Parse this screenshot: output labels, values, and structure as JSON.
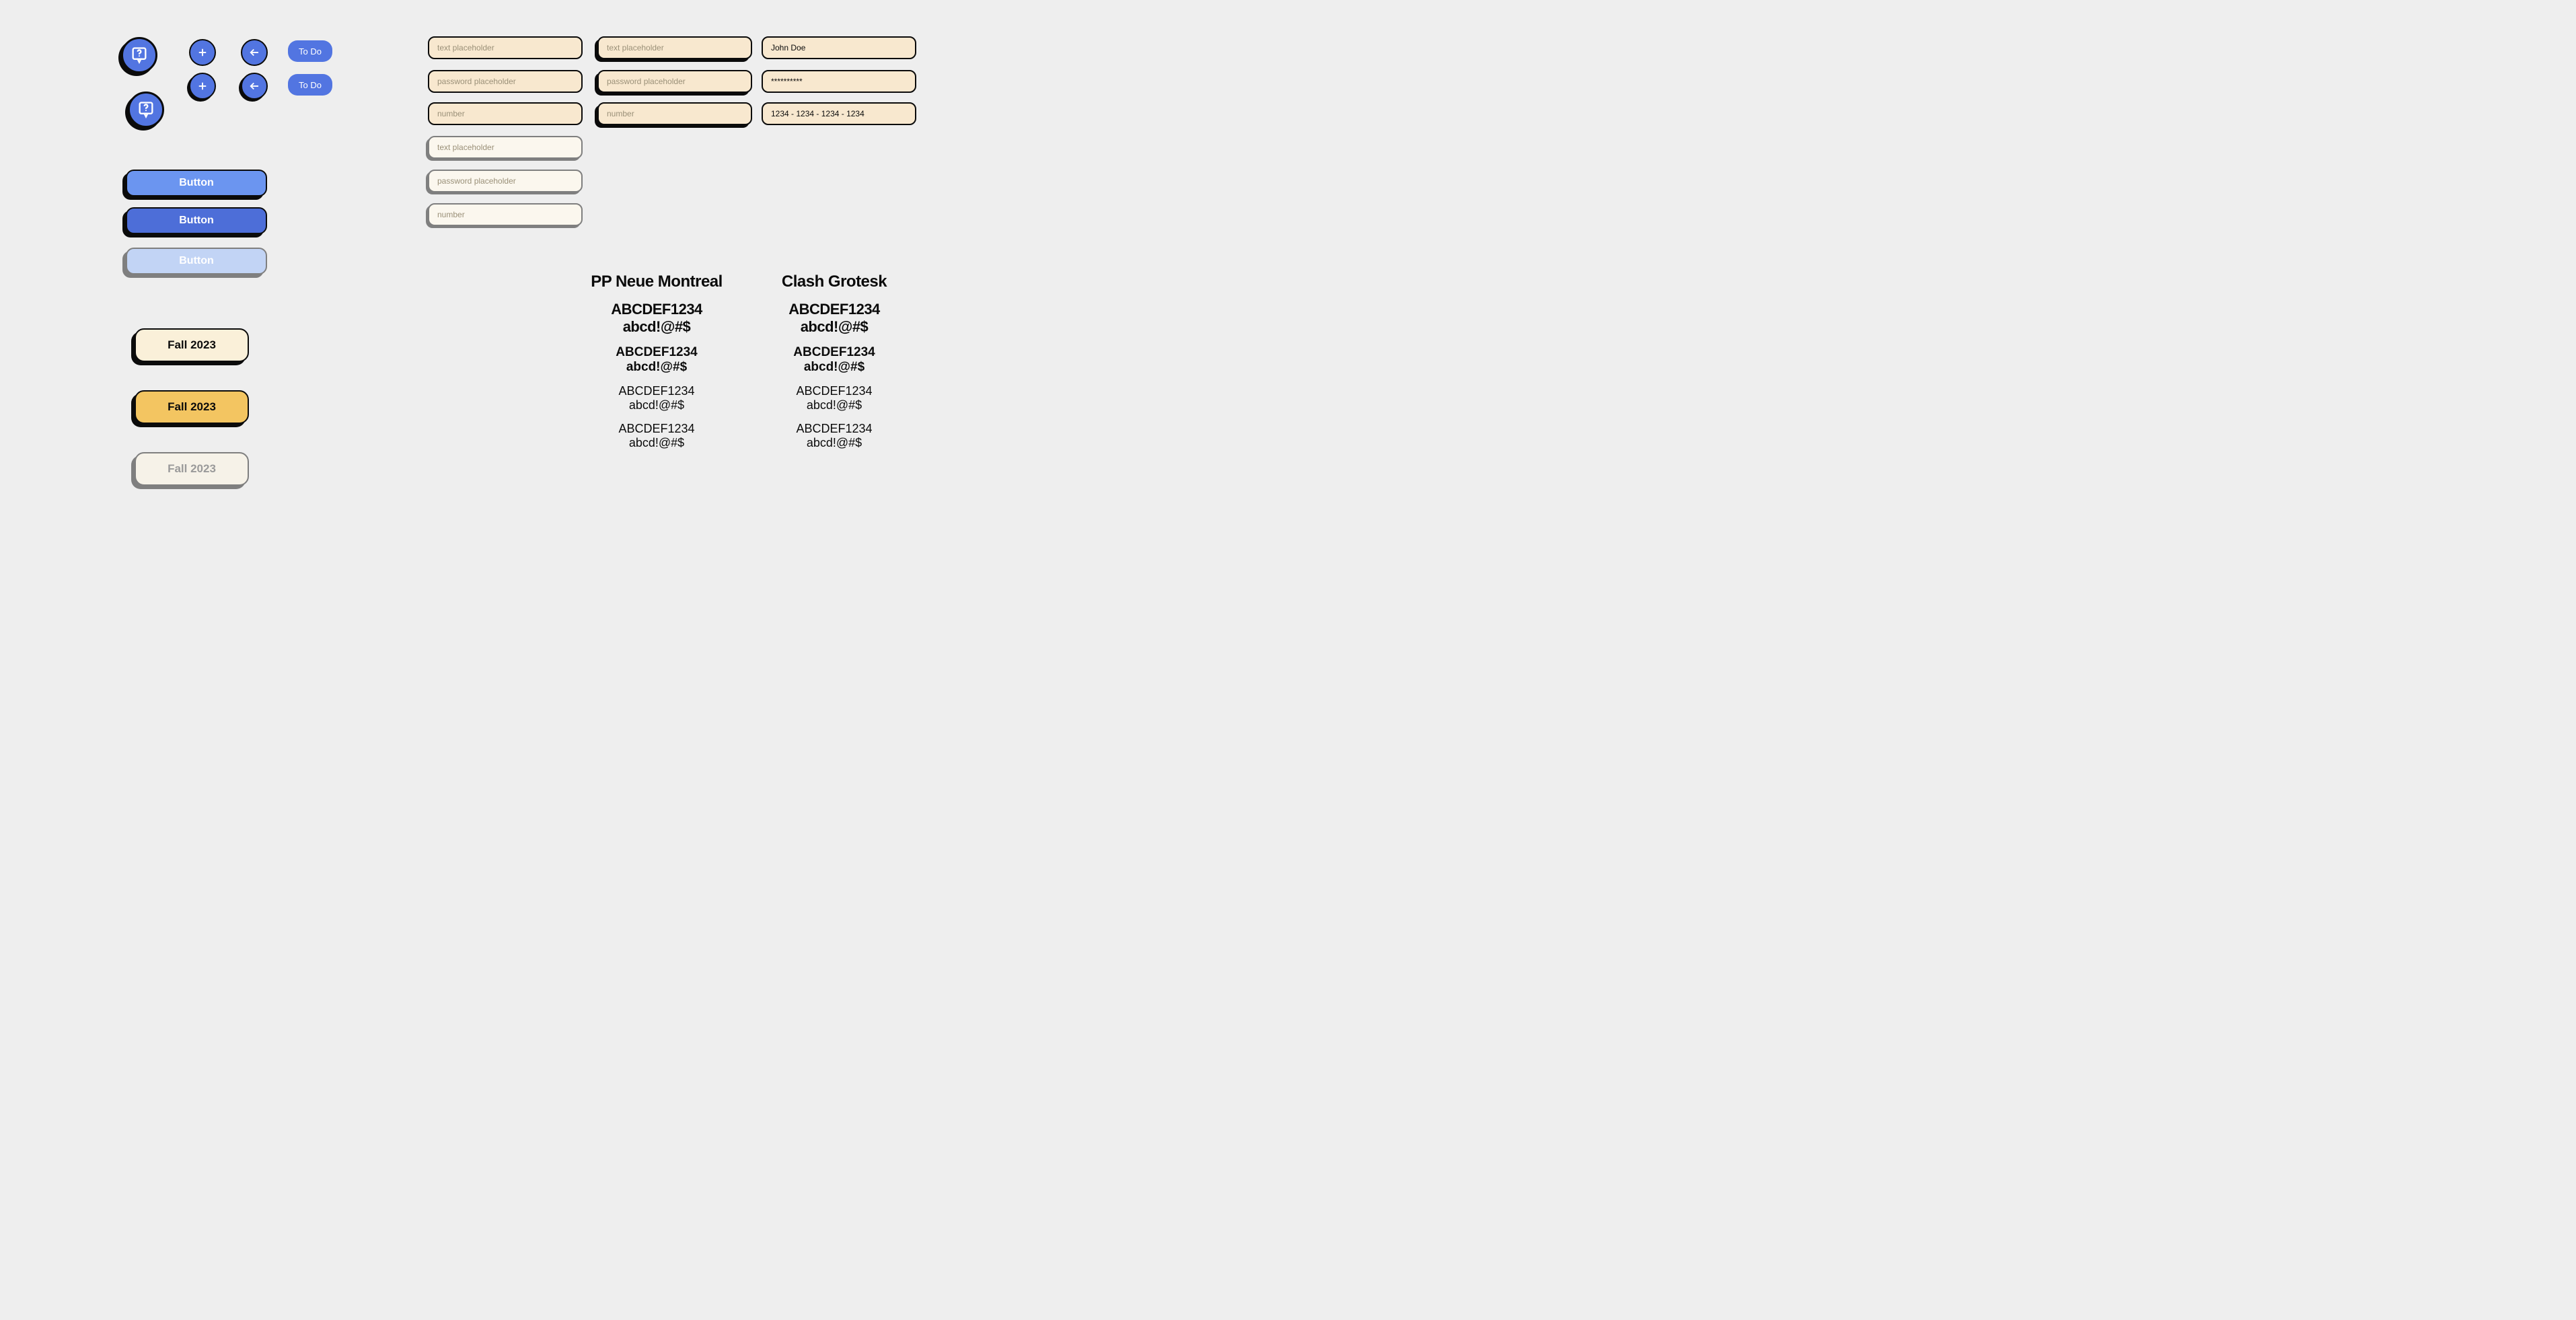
{
  "pills": {
    "todo": "To Do"
  },
  "buttons": {
    "primary1": "Button",
    "primary2": "Button",
    "primary3": "Button"
  },
  "chips": {
    "c1": "Fall 2023",
    "c2": "Fall 2023",
    "c3": "Fall 2023"
  },
  "inputs": {
    "text_ph": "text placeholder",
    "password_ph": "password placeholder",
    "number_ph": "number",
    "name_val": "John Doe",
    "pass_val": "**********",
    "num_val": "1234 - 1234 - 1234 - 1234"
  },
  "typography": {
    "col1_title": "PP Neue Montreal",
    "col2_title": "Clash Grotesk",
    "upper": "ABCDEF1234",
    "lower": "abcd!@#$"
  }
}
